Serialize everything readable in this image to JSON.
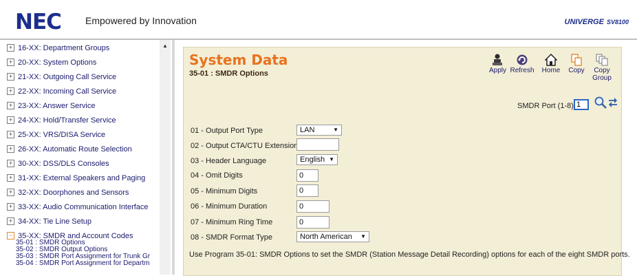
{
  "header": {
    "logo": "NEC",
    "tagline": "Empowered by Innovation",
    "product": "UNIVERGE",
    "model": "SV8100"
  },
  "sidebar": {
    "items": [
      {
        "label": "16-XX: Department Groups",
        "expanded": false
      },
      {
        "label": "20-XX: System Options",
        "expanded": false
      },
      {
        "label": "21-XX: Outgoing Call Service",
        "expanded": false
      },
      {
        "label": "22-XX: Incoming Call Service",
        "expanded": false
      },
      {
        "label": "23-XX: Answer Service",
        "expanded": false
      },
      {
        "label": "24-XX: Hold/Transfer Service",
        "expanded": false
      },
      {
        "label": "25-XX: VRS/DISA Service",
        "expanded": false
      },
      {
        "label": "26-XX: Automatic Route Selection",
        "expanded": false
      },
      {
        "label": "30-XX: DSS/DLS Consoles",
        "expanded": false
      },
      {
        "label": "31-XX: External Speakers and Paging",
        "expanded": false
      },
      {
        "label": "32-XX: Doorphones and Sensors",
        "expanded": false
      },
      {
        "label": "33-XX: Audio Communication Interface",
        "expanded": false
      },
      {
        "label": "34-XX: Tie Line Setup",
        "expanded": false
      },
      {
        "label": "35-XX: SMDR and Account Codes",
        "expanded": true
      }
    ],
    "subitems": [
      "35-01 : SMDR Options",
      "35-02 : SMDR Output Options",
      "35-03 : SMDR Port Assignment for Trunk Gr",
      "35-04 : SMDR Port Assignment for Departm"
    ]
  },
  "main": {
    "title": "System Data",
    "subtitle": "35-01 : SMDR Options",
    "toolbar": {
      "apply": "Apply",
      "refresh": "Refresh",
      "home": "Home",
      "copy": "Copy",
      "copy_group_1": "Copy",
      "copy_group_2": "Group"
    },
    "port": {
      "label": "SMDR Port (1-8)",
      "value": "1"
    },
    "options": [
      {
        "label": "01 - Output Port Type",
        "value": "LAN"
      },
      {
        "label": "02 - Output CTA/CTU Extension",
        "value": ""
      },
      {
        "label": "03 - Header Language",
        "value": "English"
      },
      {
        "label": "04 - Omit Digits",
        "value": "0"
      },
      {
        "label": "05 - Minimum Digits",
        "value": "0"
      },
      {
        "label": "06 - Minimum Duration",
        "value": "0"
      },
      {
        "label": "07 - Minimum Ring Time",
        "value": "0"
      },
      {
        "label": "08 - SMDR Format Type",
        "value": "North American"
      }
    ],
    "note": "Use Program 35-01: SMDR Options to set the SMDR (Station Message Detail Recording) options for each of the eight SMDR ports."
  },
  "colors": {
    "brand_blue": "#1c2d8c",
    "title_orange": "#e8731f",
    "panel_bg": "#f3eed6",
    "link": "#1a1a6e"
  }
}
